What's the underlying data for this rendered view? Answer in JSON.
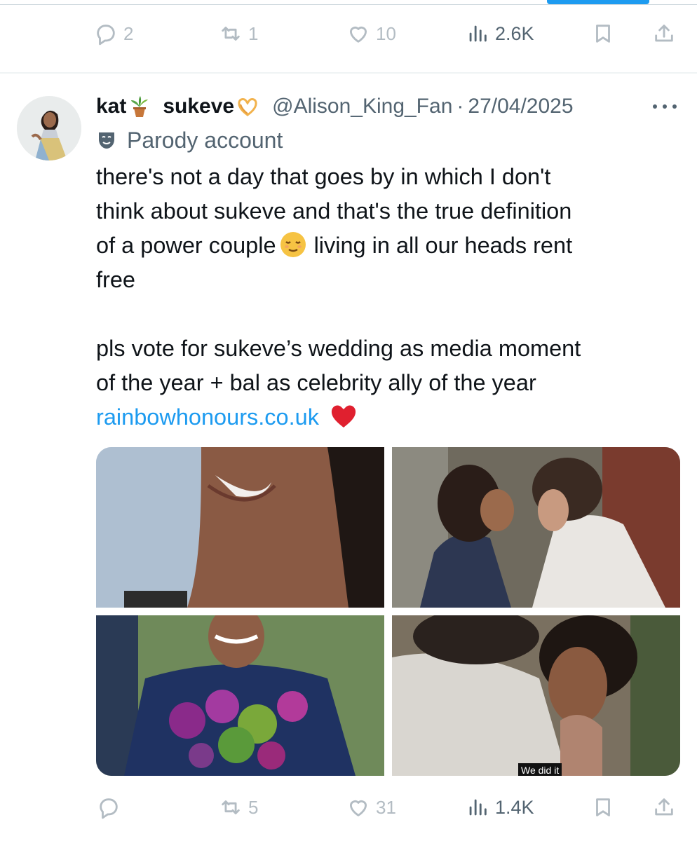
{
  "top_actions": {
    "replies": "2",
    "reposts": "1",
    "likes": "10",
    "views": "2.6K"
  },
  "tweet": {
    "display_name_a": "kat",
    "display_name_b": "sukeve",
    "name_emoji_1": "potted-plant-emoji",
    "name_emoji_2": "heart-hands-emoji",
    "handle": "@Alison_King_Fan",
    "separator": "·",
    "date": "27/04/2025",
    "label": "Parody account",
    "text_lines": [
      "there's not a day that goes by in which I don't",
      "think about sukeve and that's the true definition",
      "of a power couple",
      "living in all our heads rent",
      "free",
      "pls vote for sukeve’s wedding as media moment",
      "of the year + bal as celebrity ally of the year"
    ],
    "link": "rainbowhonours.co.uk",
    "media_caption": "We did it",
    "actions": {
      "replies": "",
      "reposts": "5",
      "likes": "31",
      "views": "1.4K"
    }
  },
  "colors": {
    "link": "#1d9bf0",
    "muted": "#536471",
    "faded": "#b3bcc3"
  }
}
